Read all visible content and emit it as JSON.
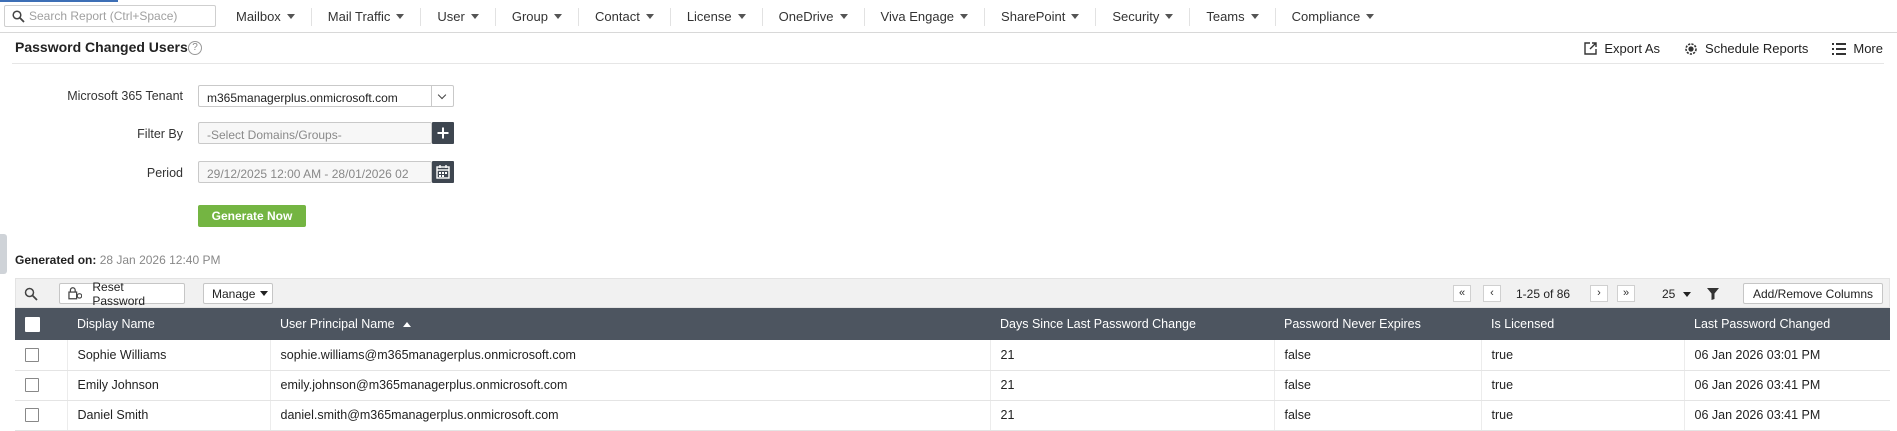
{
  "topnav": {
    "search_placeholder": "Search Report (Ctrl+Space)",
    "menus": [
      "Mailbox",
      "Mail Traffic",
      "User",
      "Group",
      "Contact",
      "License",
      "OneDrive",
      "Viva Engage",
      "SharePoint",
      "Security",
      "Teams",
      "Compliance"
    ]
  },
  "page": {
    "title": "Password Changed Users",
    "help": "?",
    "actions": {
      "export": "Export As",
      "schedule": "Schedule Reports",
      "more": "More"
    }
  },
  "form": {
    "tenant_label": "Microsoft 365 Tenant",
    "tenant_value": "m365managerplus.onmicrosoft.com",
    "filter_label": "Filter By",
    "filter_placeholder": "-Select Domains/Groups-",
    "period_label": "Period",
    "period_value": "29/12/2025 12:00 AM - 28/01/2026 02",
    "generate_label": "Generate Now"
  },
  "generated": {
    "label": "Generated on:",
    "value": "28 Jan 2026 12:40 PM"
  },
  "toolbar": {
    "reset_password": "Reset Password",
    "manage": "Manage",
    "page_range": "1-25 of 86",
    "page_size": "25",
    "add_remove_columns": "Add/Remove Columns"
  },
  "table": {
    "columns": [
      "Display Name",
      "User Principal Name",
      "Days Since Last Password Change",
      "Password Never Expires",
      "Is Licensed",
      "Last Password Changed"
    ],
    "rows": [
      [
        "Sophie Williams",
        "sophie.williams@m365managerplus.onmicrosoft.com",
        "21",
        "false",
        "true",
        "06 Jan 2026 03:01 PM"
      ],
      [
        "Emily Johnson",
        "emily.johnson@m365managerplus.onmicrosoft.com",
        "21",
        "false",
        "true",
        "06 Jan 2026 03:41 PM"
      ],
      [
        "Daniel Smith",
        "daniel.smith@m365managerplus.onmicrosoft.com",
        "21",
        "false",
        "true",
        "06 Jan 2026 03:41 PM"
      ]
    ]
  },
  "colors": {
    "header_bg": "#4d5560",
    "generate_btn": "#74b542",
    "accent": "#3d6fb6"
  }
}
